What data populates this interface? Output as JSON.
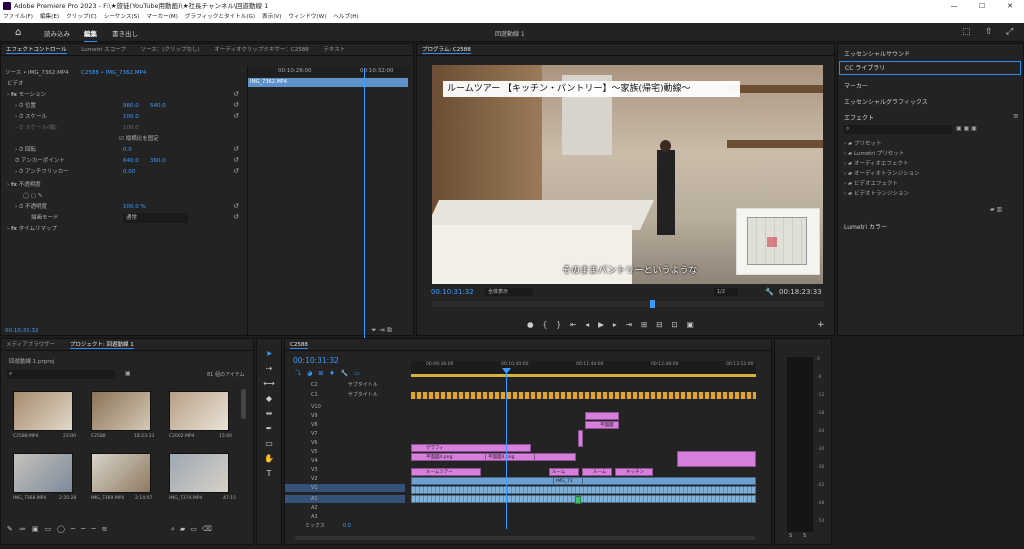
{
  "app": {
    "title": "Adobe Premiere Pro 2023 - F:\\★旅徒(YouTube用動画)\\★社長チャンネル\\回遊動線 1",
    "window_minimize": "—",
    "window_maximize": "☐",
    "window_close": "✕"
  },
  "menu": [
    "ファイル(F)",
    "編集(E)",
    "クリップ(C)",
    "シーケンス(S)",
    "マーカー(M)",
    "グラフィックとタイトル(G)",
    "表示(V)",
    "ウィンドウ(W)",
    "ヘルプ(H)"
  ],
  "workspace": {
    "tabs": [
      "読み込み",
      "編集",
      "書き出し"
    ],
    "active": "編集",
    "center_title": "回遊動線 1"
  },
  "effect_controls": {
    "tabs": [
      "エフェクトコントロール",
      "Lumetri スコープ",
      "ソース：(クリップなし)",
      "オーディオクリップミキサー：C2588",
      "テキスト"
    ],
    "source": "ソース • IMG_7362.MP4",
    "sequence": "C2588 • IMG_7362.MP4",
    "video_label": "ビデオ",
    "motion": "モーション",
    "position_label": "位置",
    "position_x": "960.0",
    "position_y": "540.0",
    "scale_label": "スケール",
    "scale_value": "100.0",
    "scale_width_label": "スケール(幅)",
    "scale_width_value": "100.0",
    "uniform_label": "縦横比を固定",
    "rotation_label": "回転",
    "rotation_value": "0.0",
    "anchor_label": "アンカーポイント",
    "anchor_x": "640.0",
    "anchor_y": "360.0",
    "flicker_label": "アンチフリッカー",
    "flicker_value": "0.00",
    "opacity": "不透明度",
    "opacity_label": "不透明度",
    "opacity_value": "100.0 %",
    "blend_label": "描画モード",
    "blend_value": "通常",
    "time_remap": "タイムリマップ",
    "ruler_a": "00:10:28:00",
    "ruler_b": "00:10:32:00",
    "clip_name": "IMG_7362.MP4",
    "timecode": "00:10:31:32"
  },
  "program": {
    "tab": "プログラム: C2588",
    "overlay_title": "ルームツアー 【キッチン・パントリー】〜家族(帰宅)動線〜",
    "subtitle": "そのままパントリーというような",
    "timecode": "00:10:31:32",
    "fit": "全体表示",
    "resolution": "1/2",
    "duration": "00:18:23:33"
  },
  "right_panel": {
    "essential_sound": "エッセンシャルサウンド",
    "cc_library": "CC ライブラリ",
    "markers": "マーカー",
    "essential_graphics": "エッセンシャルグラフィックス",
    "effects": "エフェクト",
    "effects_list": [
      "プリセット",
      "Lumetri プリセット",
      "オーディオエフェクト",
      "オーディオトランジション",
      "ビデオエフェクト",
      "ビデオトランジション"
    ],
    "lumetri_color": "Lumetri カラー"
  },
  "project": {
    "tabs": [
      "メディアブラウザー",
      "プロジェクト: 回遊動線 1"
    ],
    "file": "回遊動線 1.prproj",
    "count": "81 個のアイテム",
    "items": [
      {
        "name": "C2588.MP4",
        "dur": "23:00"
      },
      {
        "name": "C2588",
        "dur": "18:23:33"
      },
      {
        "name": "C2002.MP4",
        "dur": "15:00"
      },
      {
        "name": "IMG_7368.MP4",
        "dur": "2:35:28"
      },
      {
        "name": "IMG_7369.MP4",
        "dur": "2:14:07"
      },
      {
        "name": "IMG_7374.MP4",
        "dur": "47:15"
      }
    ]
  },
  "timeline": {
    "tab": "C2588",
    "timecode": "00:10:31:32",
    "ruler": [
      "00:09:36:00",
      "00:10:40:00",
      "00:11:44:00",
      "00:12:48:00",
      "00:13:52:00"
    ],
    "tracks": [
      "C2",
      "C1",
      "V10",
      "V9",
      "V8",
      "V7",
      "V6",
      "V5",
      "V4",
      "V3",
      "V2",
      "V1",
      "A1",
      "A2",
      "A3",
      "ミックス"
    ],
    "caption_label": "サブタイトル",
    "mix_value": "0.0",
    "clip_labels": {
      "graphic": "グラフィ",
      "plan1": "平面図4.png",
      "plan2": "平面図4.png",
      "tour": "ルームツアー",
      "room": "ルーム",
      "room2": "ルーム",
      "kitchen": "キッチン",
      "flat": "平面図",
      "img": "IMG_73"
    }
  },
  "meter": {
    "ticks": [
      "0",
      "-6",
      "-12",
      "-18",
      "-24",
      "-30",
      "-36",
      "-42",
      "-48",
      "-54"
    ],
    "bottom": [
      "S",
      "S"
    ]
  }
}
